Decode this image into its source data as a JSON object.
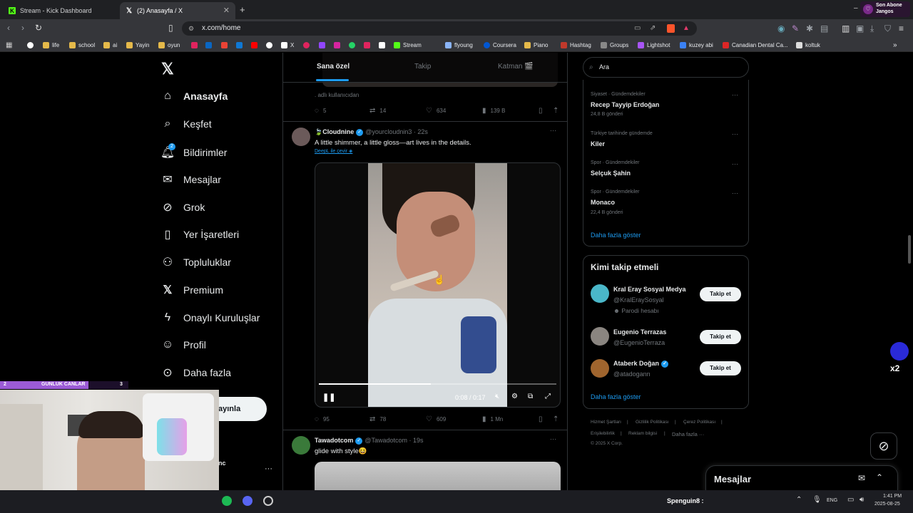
{
  "browser": {
    "tabs": [
      {
        "title": "Stream - Kick Dashboard"
      },
      {
        "title": "(2) Anasayfa / X"
      }
    ],
    "url": "x.com/home",
    "profile": {
      "line1": "Son Abone",
      "line2": "Jangos"
    },
    "bookmarks": [
      "life",
      "school",
      "ai",
      "Yayin",
      "oyun",
      "X",
      "Stream",
      "flyoung",
      "Coursera",
      "Piano",
      "Hashtag",
      "Groups",
      "Lightshot",
      "kuzey abi",
      "Canadian Dental Ca...",
      "koltuk"
    ]
  },
  "nav": {
    "items": [
      {
        "label": "Anasayfa",
        "icon": "home-icon"
      },
      {
        "label": "Keşfet",
        "icon": "search-icon"
      },
      {
        "label": "Bildirimler",
        "icon": "bell-icon",
        "badge": "2"
      },
      {
        "label": "Mesajlar",
        "icon": "envelope-icon"
      },
      {
        "label": "Grok",
        "icon": "grok-icon"
      },
      {
        "label": "Yer İşaretleri",
        "icon": "bookmark-icon"
      },
      {
        "label": "Topluluklar",
        "icon": "people-icon"
      },
      {
        "label": "Premium",
        "icon": "x-icon"
      },
      {
        "label": "Onaylı Kuruluşlar",
        "icon": "lightning-icon"
      },
      {
        "label": "Profil",
        "icon": "person-icon"
      },
      {
        "label": "Daha fazla",
        "icon": "more-circle-icon"
      }
    ],
    "post_button": "ayınla"
  },
  "feed": {
    "tabs": [
      "Sana özel",
      "Takip",
      "Katman 🎬"
    ],
    "prev_post": {
      "caption": "adlı kullanıcıdan",
      "replies": "5",
      "reposts": "14",
      "likes": "634",
      "views": "139 B"
    },
    "post1": {
      "name": "🍃Cloudnine",
      "handle": "@yourcloudnin3",
      "time": "22s",
      "text": "A little shimmer, a little gloss—art lives in the details.",
      "translate": "DeepL ile çevir",
      "video_time": "0:08 / 0:17",
      "replies": "95",
      "reposts": "78",
      "likes": "609",
      "views": "1 Mn"
    },
    "post2": {
      "name": "Tawadotcom",
      "handle": "@Tawadotcom",
      "time": "19s",
      "text": "glide with style😆"
    }
  },
  "sidebar": {
    "search_placeholder": "Ara",
    "trends": [
      {
        "meta": "Siyaset · Gündemdekiler",
        "title": "Recep Tayyip Erdoğan",
        "count": "24,8 B gönderi"
      },
      {
        "meta": "Türkiye tarihinde gündemde",
        "title": "Kiler",
        "count": ""
      },
      {
        "meta": "Spor · Gündemdekiler",
        "title": "Selçuk Şahin",
        "count": ""
      },
      {
        "meta": "Spor · Gündemdekiler",
        "title": "Monaco",
        "count": "22,4 B gönderi"
      }
    ],
    "show_more": "Daha fazla göster",
    "who_to_follow_title": "Kimi takip etmeli",
    "suggestions": [
      {
        "name": "Kral Eray Sosyal Medya",
        "handle": "@KralEraySosyal",
        "extra": "Parodi hesabı",
        "button": "Takip et"
      },
      {
        "name": "Eugenio Terrazas",
        "handle": "@EugenioTerraza",
        "button": "Takip et"
      },
      {
        "name": "Ataberk Doğan",
        "handle": "@atadogann",
        "button": "Takip et"
      }
    ],
    "show_more2": "Daha fazla göster",
    "footer": [
      "Hizmet Şartları",
      "Gizlilik Politikası",
      "Çerez Politikası",
      "Erişilebilirlik",
      "Reklam bilgisi",
      "Daha fazla ···",
      "© 2025 X Corp."
    ]
  },
  "messages_drawer": {
    "title": "Mesajlar"
  },
  "overlay": {
    "bar_left": "2",
    "bar_mid": "GUNLUK CANLAR",
    "bar_right": "3",
    "spenguin": "Spenguin8 :"
  },
  "taskbar": {
    "lang": "ENG",
    "time": "1:41 PM",
    "date": "2025-08-25"
  },
  "colors": {
    "accent": "#1d9bf0",
    "bg": "#000000",
    "border": "#2f3336",
    "kick_green": "#53fc18"
  }
}
